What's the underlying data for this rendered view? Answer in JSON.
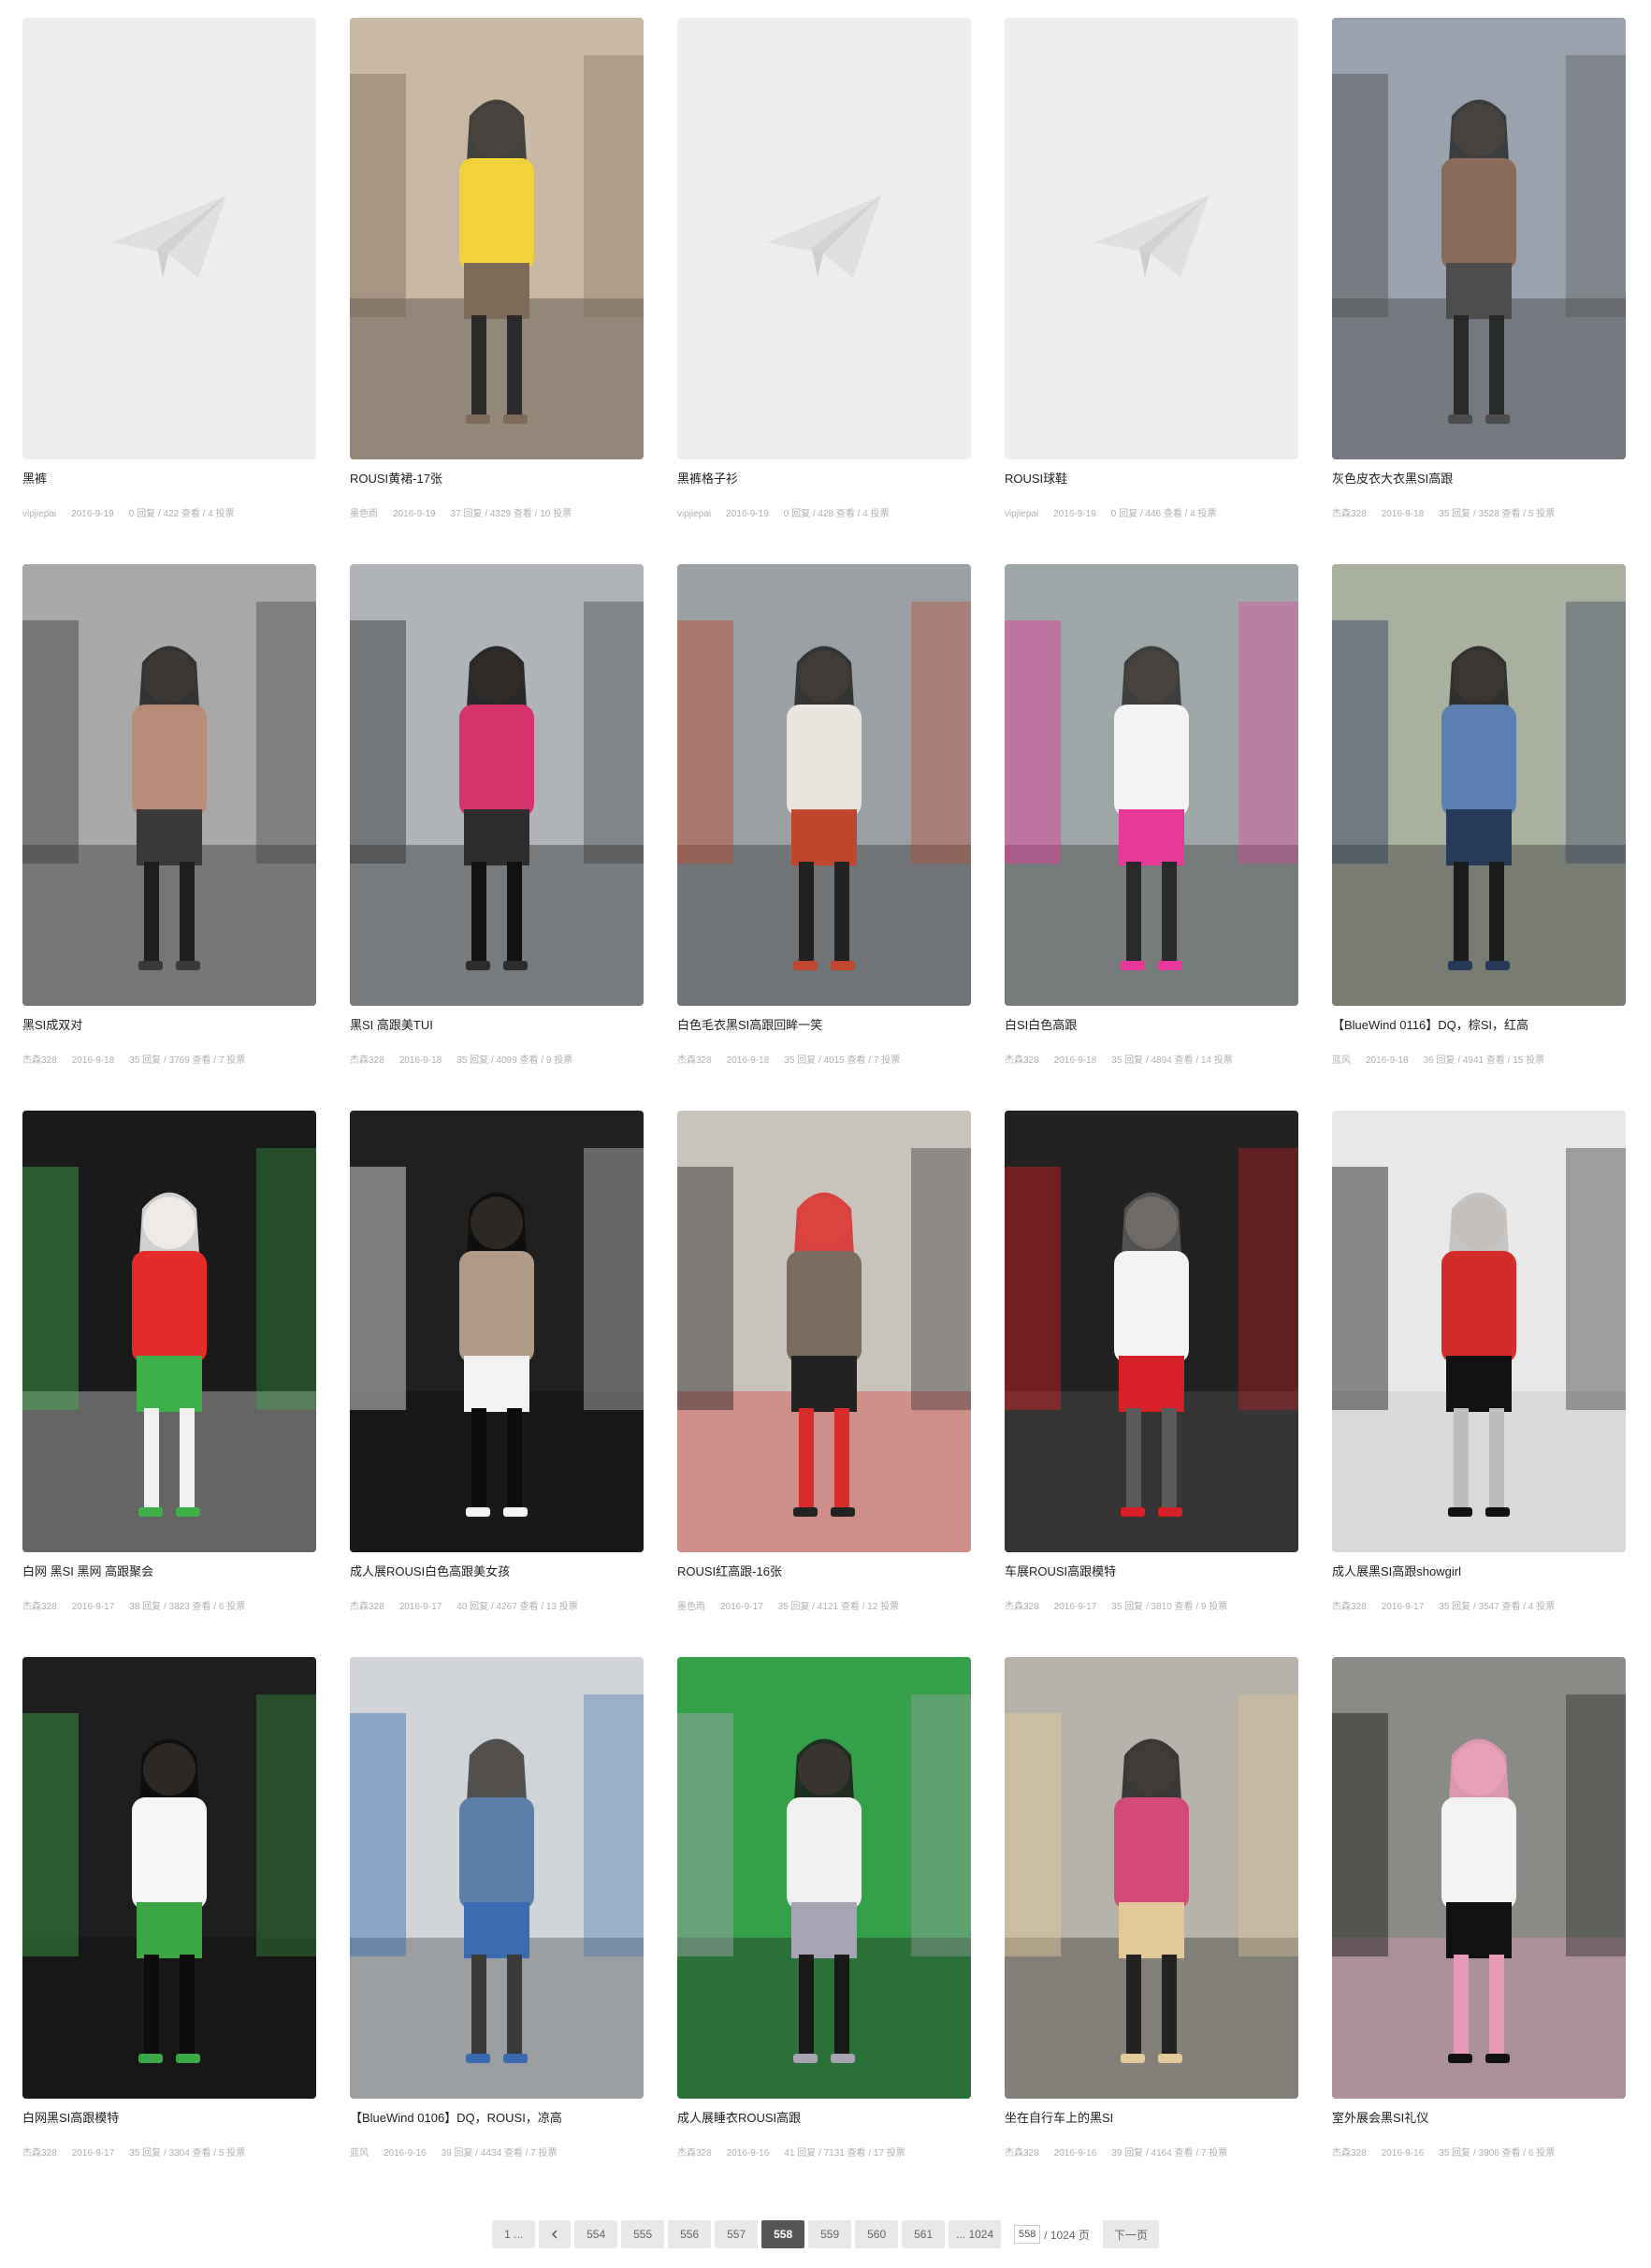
{
  "colors": {
    "placeholder_bg": "#eeeeee",
    "current_page_bg": "#555555",
    "page_bg": "#e9e9e9"
  },
  "posts": [
    {
      "title": "黑裤",
      "author": "vipjiepai",
      "date": "2016-9-19",
      "stats": "0 回复 / 422 查看 / 4 投票",
      "image": "placeholder"
    },
    {
      "title": "ROUSI黄裙-17张",
      "author": "墨色雨",
      "date": "2016-9-19",
      "stats": "37 回复 / 4329 查看 / 10 投票",
      "image": "photo"
    },
    {
      "title": "黑裤格子衫",
      "author": "vipjiepai",
      "date": "2016-9-19",
      "stats": "0 回复 / 428 查看 / 4 投票",
      "image": "placeholder"
    },
    {
      "title": "ROUSI球鞋",
      "author": "vipjiepai",
      "date": "2016-9-19",
      "stats": "0 回复 / 446 查看 / 4 投票",
      "image": "placeholder"
    },
    {
      "title": "灰色皮衣大衣黑SI高跟",
      "author": "杰森328",
      "date": "2016-9-18",
      "stats": "35 回复 / 3528 查看 / 5 投票",
      "image": "photo"
    },
    {
      "title": "黑SI成双对",
      "author": "杰森328",
      "date": "2016-9-18",
      "stats": "35 回复 / 3769 查看 / 7 投票",
      "image": "photo"
    },
    {
      "title": "黑SI 高跟美TUI",
      "author": "杰森328",
      "date": "2016-9-18",
      "stats": "35 回复 / 4099 查看 / 9 投票",
      "image": "photo"
    },
    {
      "title": "白色毛衣黑SI高跟回眸一笑",
      "author": "杰森328",
      "date": "2016-9-18",
      "stats": "35 回复 / 4015 查看 / 7 投票",
      "image": "photo"
    },
    {
      "title": "白SI白色高跟",
      "author": "杰森328",
      "date": "2016-9-18",
      "stats": "35 回复 / 4894 查看 / 14 投票",
      "image": "photo"
    },
    {
      "title": "【BlueWind 0116】DQ，棕SI，红高",
      "author": "蓝风",
      "date": "2016-9-18",
      "stats": "36 回复 / 4941 查看 / 15 投票",
      "image": "photo"
    },
    {
      "title": "白网 黑SI 黑网 高跟聚会",
      "author": "杰森328",
      "date": "2016-9-17",
      "stats": "38 回复 / 3823 查看 / 6 投票",
      "image": "photo"
    },
    {
      "title": "成人展ROUSI白色高跟美女孩",
      "author": "杰森328",
      "date": "2016-9-17",
      "stats": "40 回复 / 4267 查看 / 13 投票",
      "image": "photo"
    },
    {
      "title": "ROUSI红高跟-16张",
      "author": "墨色雨",
      "date": "2016-9-17",
      "stats": "35 回复 / 4121 查看 / 12 投票",
      "image": "photo"
    },
    {
      "title": "车展ROUSI高跟模特",
      "author": "杰森328",
      "date": "2016-9-17",
      "stats": "35 回复 / 3810 查看 / 9 投票",
      "image": "photo"
    },
    {
      "title": "成人展黑SI高跟showgirl",
      "author": "杰森328",
      "date": "2016-9-17",
      "stats": "35 回复 / 3547 查看 / 4 投票",
      "image": "photo"
    },
    {
      "title": "白网黑SI高跟模特",
      "author": "杰森328",
      "date": "2016-9-17",
      "stats": "35 回复 / 3304 查看 / 5 投票",
      "image": "photo"
    },
    {
      "title": "【BlueWind 0106】DQ，ROUSI，凉高",
      "author": "蓝风",
      "date": "2016-9-16",
      "stats": "39 回复 / 4434 查看 / 7 投票",
      "image": "photo"
    },
    {
      "title": "成人展睡衣ROUSI高跟",
      "author": "杰森328",
      "date": "2016-9-16",
      "stats": "41 回复 / 7131 查看 / 17 投票",
      "image": "photo"
    },
    {
      "title": "坐在自行车上的黑SI",
      "author": "杰森328",
      "date": "2016-9-16",
      "stats": "39 回复 / 4164 查看 / 7 投票",
      "image": "photo"
    },
    {
      "title": "室外展会黑SI礼仪",
      "author": "杰森328",
      "date": "2016-9-16",
      "stats": "35 回复 / 3906 查看 / 6 投票",
      "image": "photo"
    }
  ],
  "pagination": {
    "first": "1 ...",
    "prev_icon": "chevron-left-icon",
    "pages": [
      "554",
      "555",
      "556",
      "557",
      "558",
      "559",
      "560",
      "561"
    ],
    "current": "558",
    "last": "... 1024",
    "jump_value": "558",
    "jump_total": "/ 1024 页",
    "next": "下一页"
  }
}
